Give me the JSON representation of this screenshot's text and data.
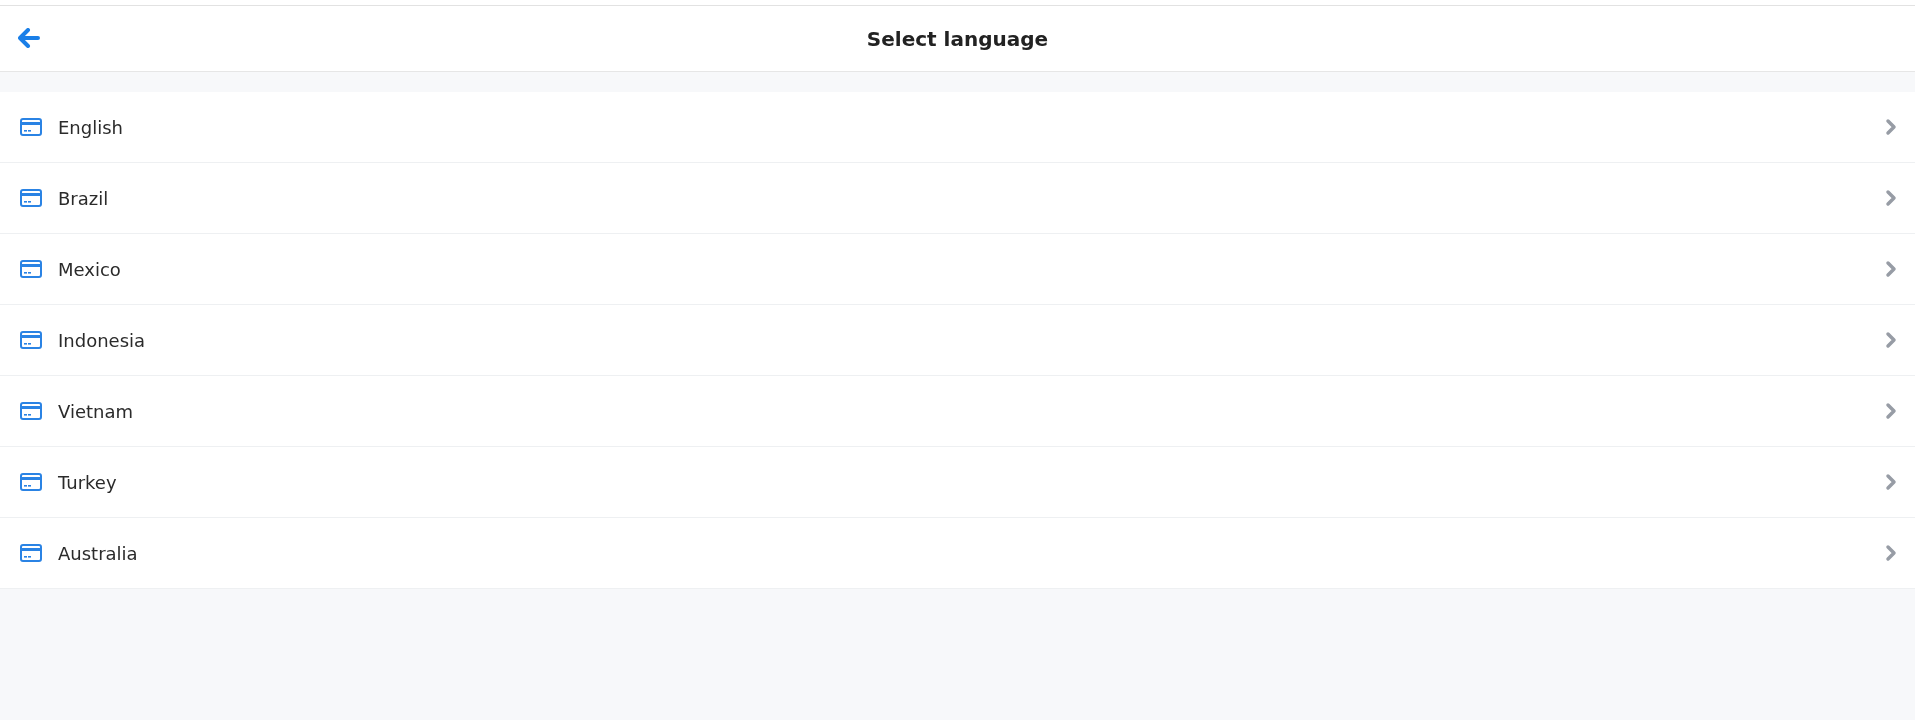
{
  "header": {
    "title": "Select language"
  },
  "languages": [
    {
      "label": "English"
    },
    {
      "label": "Brazil"
    },
    {
      "label": "Mexico"
    },
    {
      "label": "Indonesia"
    },
    {
      "label": "Vietnam"
    },
    {
      "label": "Turkey"
    },
    {
      "label": "Australia"
    }
  ]
}
